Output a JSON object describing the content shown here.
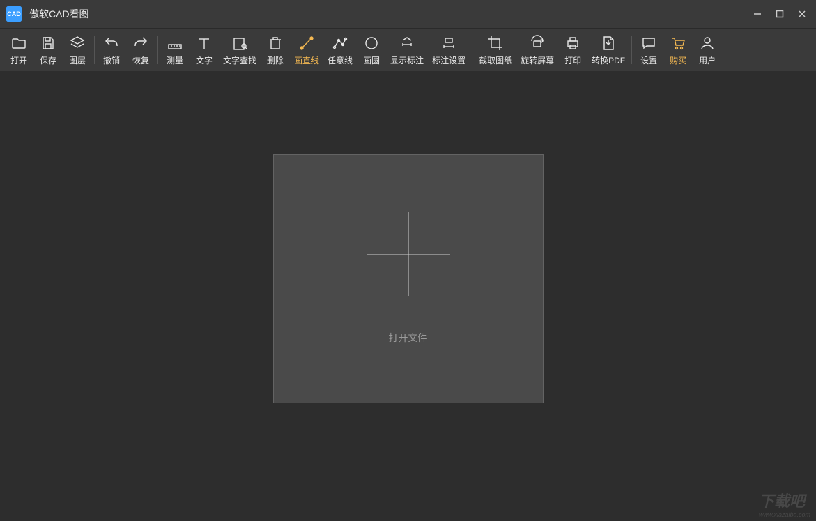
{
  "app": {
    "title": "傲软CAD看图",
    "logoText": "CAD"
  },
  "windowControls": {
    "minimize": "minimize",
    "maximize": "maximize",
    "close": "close"
  },
  "toolbar": {
    "open": "打开",
    "save": "保存",
    "layers": "图层",
    "undo": "撤销",
    "redo": "恢复",
    "measure": "测量",
    "text": "文字",
    "findText": "文字查找",
    "delete": "删除",
    "drawLine": "画直线",
    "freeLine": "任意线",
    "circle": "画圆",
    "showAnnotation": "显示标注",
    "annotationSettings": "标注设置",
    "cropDrawing": "截取图纸",
    "rotateScreen": "旋转屏幕",
    "print": "打印",
    "convertPdf": "转换PDF",
    "settings": "设置",
    "buy": "购买",
    "user": "用户"
  },
  "canvas": {
    "openFileLabel": "打开文件"
  },
  "watermark": {
    "text": "下载吧",
    "url": "www.xiazaiba.com"
  }
}
